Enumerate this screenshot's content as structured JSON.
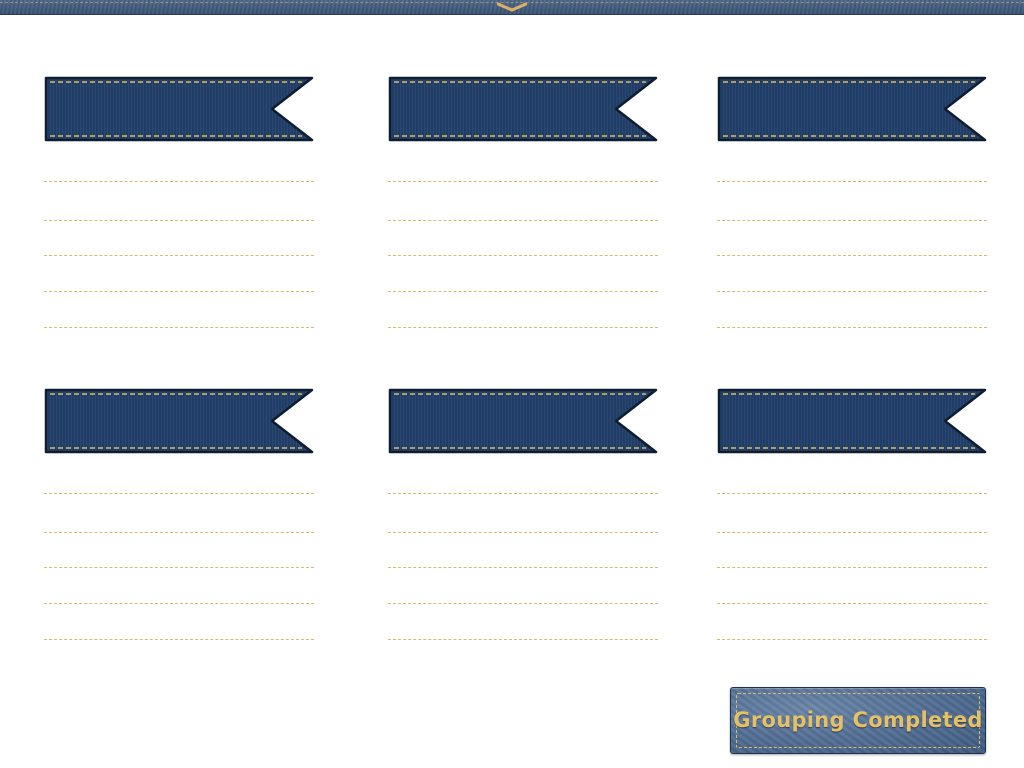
{
  "top_bar": {
    "handle_icon": "chevron-down-icon"
  },
  "groups": [
    {
      "title": "",
      "slots": [
        "",
        "",
        "",
        "",
        ""
      ]
    },
    {
      "title": "",
      "slots": [
        "",
        "",
        "",
        "",
        ""
      ]
    },
    {
      "title": "",
      "slots": [
        "",
        "",
        "",
        "",
        ""
      ]
    },
    {
      "title": "",
      "slots": [
        "",
        "",
        "",
        "",
        ""
      ]
    },
    {
      "title": "",
      "slots": [
        "",
        "",
        "",
        "",
        ""
      ]
    },
    {
      "title": "",
      "slots": [
        "",
        "",
        "",
        "",
        ""
      ]
    }
  ],
  "complete_button": {
    "label": "Grouping Completed"
  },
  "colors": {
    "ribbon_fill": "#1f3d66",
    "stitch": "#d8ba6c",
    "button_text": "#e6c066",
    "leather": "#4f6c91"
  }
}
